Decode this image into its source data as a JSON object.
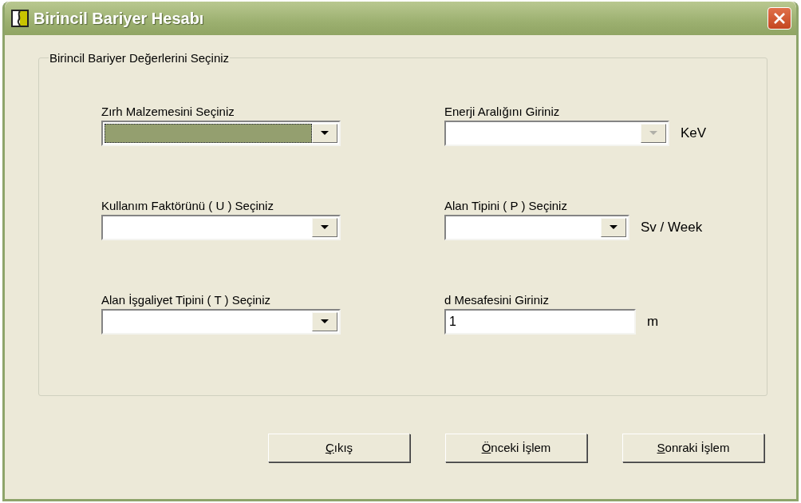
{
  "window": {
    "title": "Birincil Bariyer Hesabı"
  },
  "group": {
    "title": "Birincil Bariyer Değerlerini Seçiniz",
    "fields": [
      {
        "label": "Zırh Malzemesini Seçiniz",
        "kind": "combo",
        "focused": true,
        "disabled": false
      },
      {
        "label": "Enerji Aralığını Giriniz",
        "kind": "combo",
        "focused": false,
        "disabled": true,
        "unit": "KeV"
      },
      {
        "label": "Kullanım Faktörünü ( U ) Seçiniz",
        "kind": "combo",
        "focused": false,
        "disabled": false
      },
      {
        "label": "Alan Tipini ( P ) Seçiniz",
        "kind": "combo",
        "focused": false,
        "disabled": false,
        "unit": "Sv / Week"
      },
      {
        "label": "Alan İşgaliyet Tipini ( T ) Seçiniz",
        "kind": "combo",
        "focused": false,
        "disabled": false
      },
      {
        "label": "d Mesafesini Giriniz",
        "kind": "text",
        "value": "1",
        "unit": "m"
      }
    ]
  },
  "buttons": [
    {
      "label": "Çıkış",
      "mnemonic": true
    },
    {
      "label": "Önceki İşlem",
      "mnemonic": true
    },
    {
      "label": "Sonraki İşlem",
      "mnemonic": true
    }
  ]
}
